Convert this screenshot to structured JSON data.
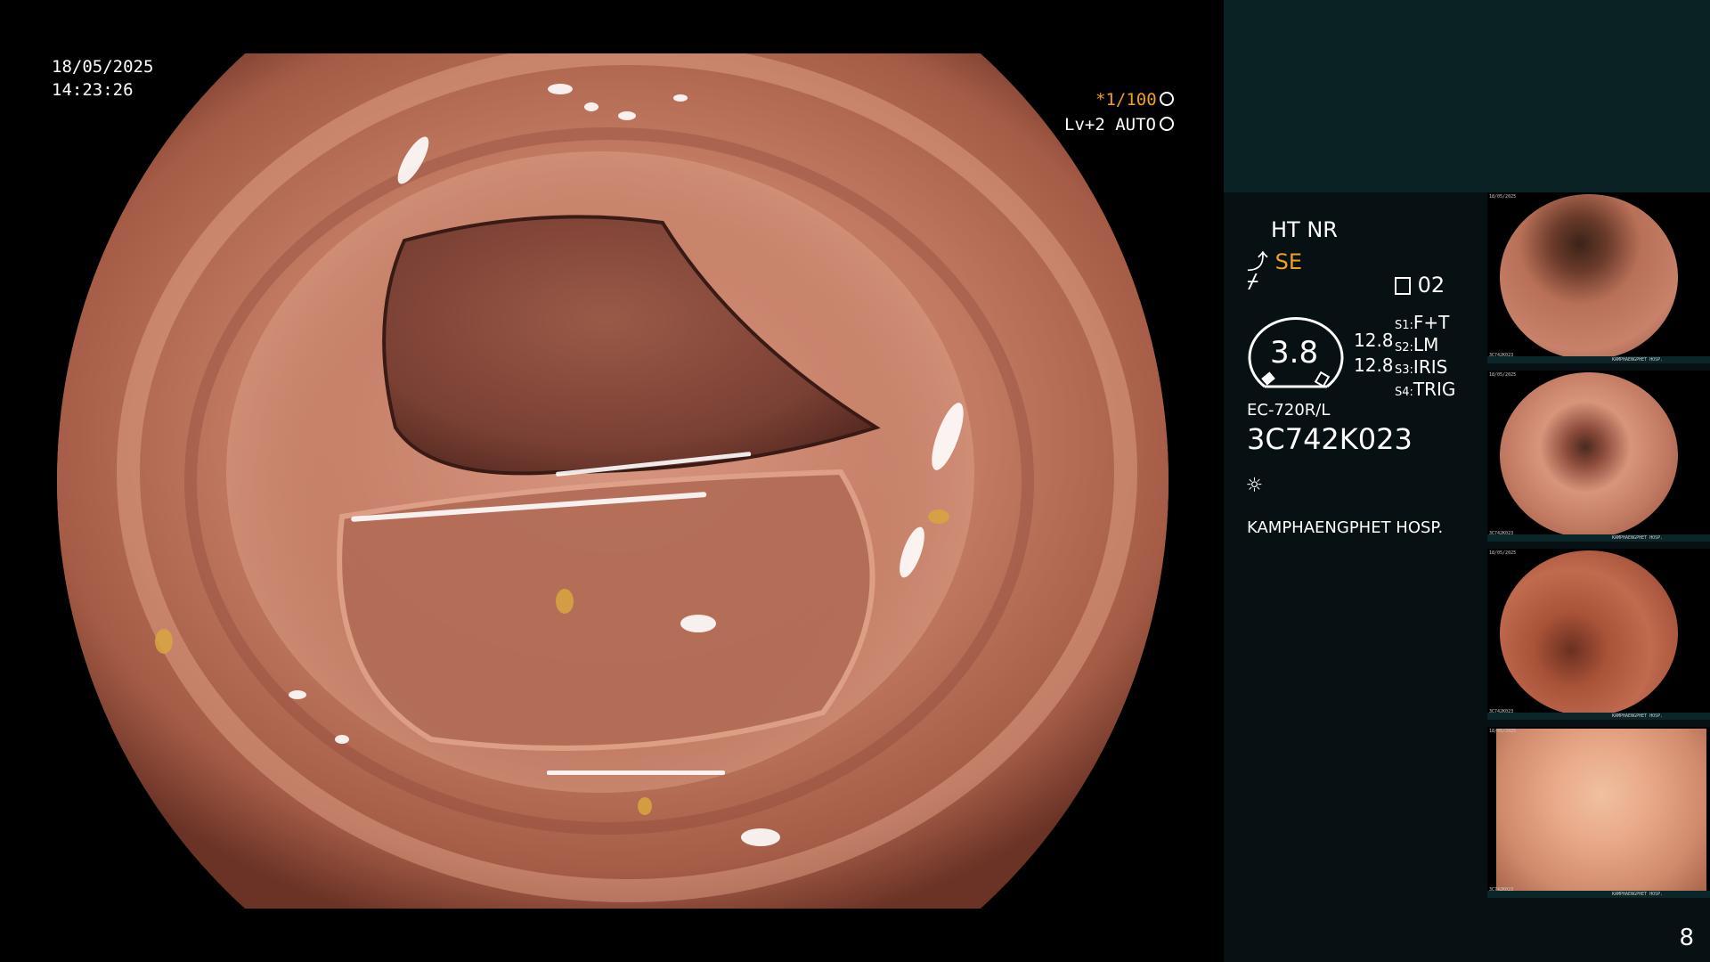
{
  "overlay": {
    "date": "18/05/2025",
    "time": "14:23:26",
    "shutter": "*1/100",
    "shutter_icon": "aperture-icon",
    "level": "Lv+2 AUTO",
    "level_icon": "auto-iris-icon"
  },
  "panel": {
    "mode_line1": "HT NR",
    "mode_se": "SE",
    "mode_se_icon": "structure-enhancement-icon",
    "mode_icon2": "contrast-icon",
    "memory_icon": "memory-card-icon",
    "memory_num": "02",
    "dial_value": "3.8",
    "dial_sub1": "12.8",
    "dial_sub2": "12.8",
    "switches": [
      {
        "key": "S1",
        "value": "F+T"
      },
      {
        "key": "S2",
        "value": "LM"
      },
      {
        "key": "S3",
        "value": "IRIS"
      },
      {
        "key": "S4",
        "value": "TRIG"
      }
    ],
    "scope_model": "EC-720R/L",
    "scope_serial": "3C742K023",
    "light_icon": "light-source-icon",
    "hospital": "KAMPHAENGPHET HOSP."
  },
  "thumbnails": [
    {
      "name": "thumbnail-1",
      "date": "18/05/2025",
      "serial": "3C742K023",
      "hospital": "KAMPHAENGPHET HOSP."
    },
    {
      "name": "thumbnail-2",
      "date": "18/05/2025",
      "serial": "3C742K023",
      "hospital": "KAMPHAENGPHET HOSP."
    },
    {
      "name": "thumbnail-3",
      "date": "18/05/2025",
      "serial": "3C742K023",
      "hospital": "KAMPHAENGPHET HOSP."
    },
    {
      "name": "thumbnail-4",
      "date": "18/05/2025",
      "serial": "3C742K023",
      "hospital": "KAMPHAENGPHET HOSP."
    }
  ],
  "page_number": "8"
}
